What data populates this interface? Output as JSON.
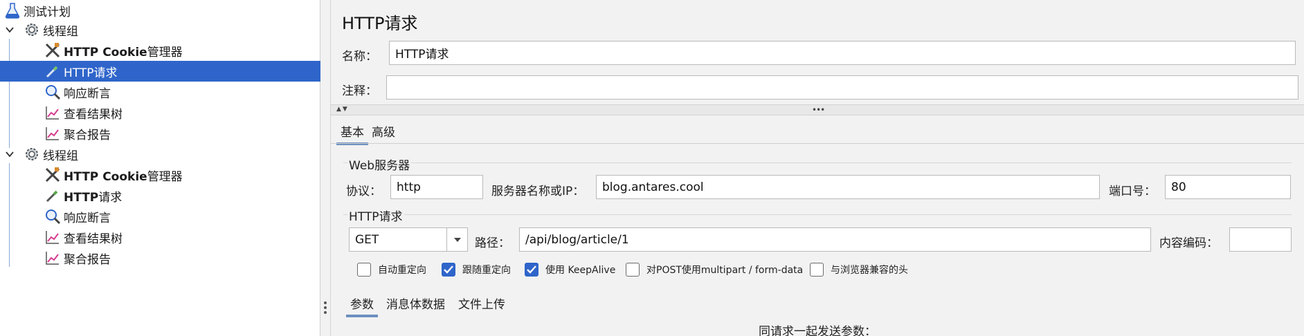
{
  "tree": {
    "root": {
      "label": "测试计划",
      "icon": "flask-icon"
    },
    "groups": [
      {
        "label": "线程组",
        "icon": "gear-icon",
        "expanded": true,
        "children": [
          {
            "label_bold": "HTTP Cookie",
            "label_rest": "管理器",
            "icon": "cookie-tools-icon"
          },
          {
            "label_bold": "HTTP",
            "label_rest": "请求",
            "icon": "pipette-icon",
            "selected": true
          },
          {
            "label_bold": "",
            "label_rest": "响应断言",
            "icon": "magnifier-icon"
          },
          {
            "label_bold": "",
            "label_rest": "查看结果树",
            "icon": "graph-icon"
          },
          {
            "label_bold": "",
            "label_rest": "聚合报告",
            "icon": "graph-icon"
          }
        ]
      },
      {
        "label": "线程组",
        "icon": "gear-icon",
        "expanded": true,
        "children": [
          {
            "label_bold": "HTTP Cookie",
            "label_rest": "管理器",
            "icon": "cookie-tools-icon"
          },
          {
            "label_bold": "HTTP",
            "label_rest": "请求",
            "icon": "pipette-icon"
          },
          {
            "label_bold": "",
            "label_rest": "响应断言",
            "icon": "magnifier-icon"
          },
          {
            "label_bold": "",
            "label_rest": "查看结果树",
            "icon": "graph-icon"
          },
          {
            "label_bold": "",
            "label_rest": "聚合报告",
            "icon": "graph-icon"
          }
        ]
      }
    ]
  },
  "panel": {
    "title": "HTTP请求",
    "name_label": "名称：",
    "name_value": "HTTP请求",
    "comment_label": "注释：",
    "comment_value": "",
    "tabs": [
      "基本",
      "高级"
    ],
    "web_server": {
      "title": "Web服务器",
      "protocol_label": "协议：",
      "protocol_value": "http",
      "server_label": "服务器名称或IP：",
      "server_value": "blog.antares.cool",
      "port_label": "端口号：",
      "port_value": "80"
    },
    "http_request": {
      "title": "HTTP请求",
      "method": "GET",
      "path_label": "路径：",
      "path_value": "/api/blog/article/1",
      "encoding_label": "内容编码：",
      "encoding_value": ""
    },
    "checkboxes": [
      {
        "label": "自动重定向",
        "checked": false
      },
      {
        "label": "跟随重定向",
        "checked": true
      },
      {
        "label": "使用 KeepAlive",
        "checked": true
      },
      {
        "label": "对POST使用multipart / form-data",
        "checked": false
      },
      {
        "label": "与浏览器兼容的头",
        "checked": false
      }
    ],
    "sub_tabs": [
      "参数",
      "消息体数据",
      "文件上传"
    ],
    "params_caption": "同请求一起发送参数："
  },
  "colors": {
    "selection": "#2f65ca",
    "panel_bg": "#f2f2f2",
    "tab_underline": "#6d8fbf"
  }
}
